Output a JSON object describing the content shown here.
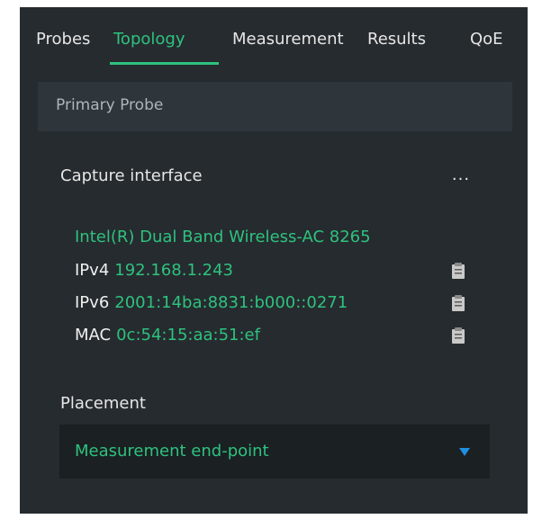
{
  "tabs": [
    {
      "label": "Probes"
    },
    {
      "label": "Topology"
    },
    {
      "label": "Measurement"
    },
    {
      "label": "Results"
    },
    {
      "label": "QoE"
    }
  ],
  "active_tab": "Topology",
  "probe_header": {
    "label": "Primary Probe"
  },
  "capture": {
    "title": "Capture interface",
    "more_label": "...",
    "interface_name": "Intel(R) Dual Band Wireless-AC 8265",
    "addresses": [
      {
        "label": "IPv4",
        "value": "192.168.1.243"
      },
      {
        "label": "IPv6",
        "value": "2001:14ba:8831:b000::0271"
      },
      {
        "label": "MAC",
        "value": "0c:54:15:aa:51:ef"
      }
    ]
  },
  "placement": {
    "title": "Placement",
    "selected": "Measurement end-point"
  },
  "colors": {
    "accent": "#2ec27e",
    "panel_bg": "#262b2f",
    "header_bg": "#2e353b",
    "select_bg": "#1b2023",
    "dropdown_arrow": "#1e8fe1"
  },
  "icons": {
    "copy": "clipboard-icon",
    "dropdown": "chevron-down-icon"
  }
}
